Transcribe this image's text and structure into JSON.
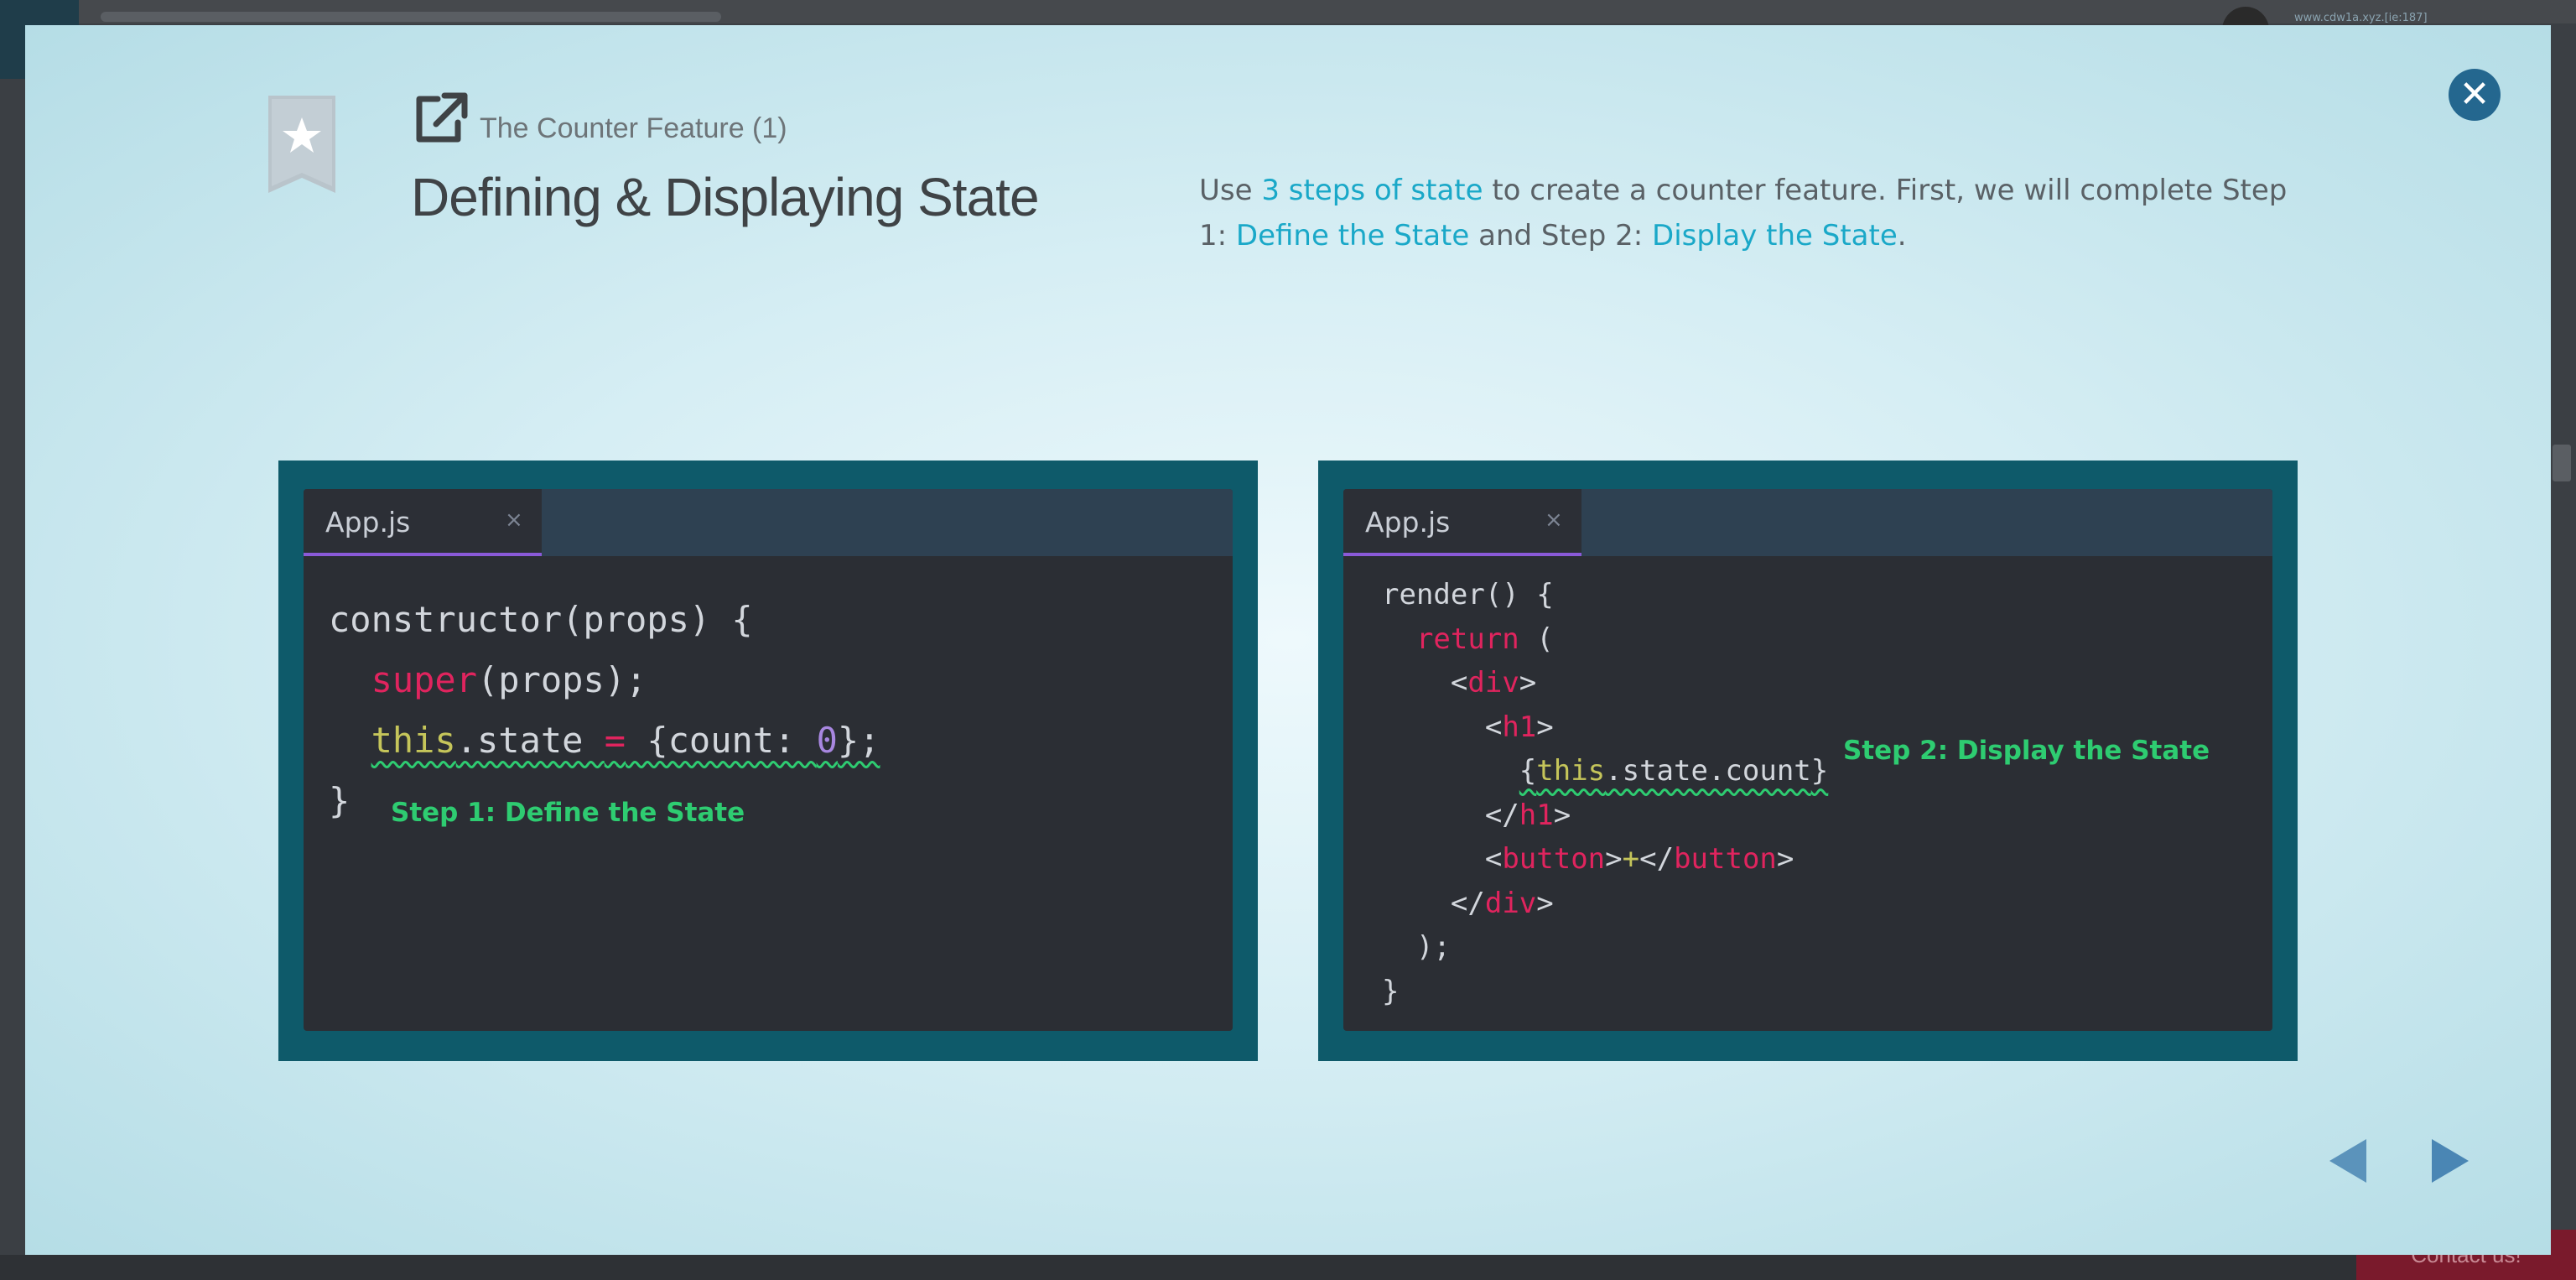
{
  "backdrop": {
    "url_text": "www.cdw1a.xyz.[ie:187]",
    "contact_label": "Contact us!"
  },
  "modal": {
    "kicker": "The Counter Feature (1)",
    "title": "Defining & Displaying State",
    "description": {
      "p1": "Use ",
      "link1": "3 steps of state",
      "p2": " to create a counter feature. First, we will complete Step 1: ",
      "link2": "Define the State",
      "p3": " and Step 2: ",
      "link3": "Display the State",
      "p4": "."
    },
    "close_icon": "close-x-icon",
    "bookmark_icon": "star-bookmark-icon",
    "external_link_icon": "external-link-icon"
  },
  "panels": {
    "left": {
      "tab_label": "App.js",
      "tab_close": "×",
      "code": {
        "l1": "constructor(props) {",
        "l2_kw": "super",
        "l2_rest": "(props);",
        "l3_this": "this",
        "l3_a": ".state ",
        "l3_eq": "=",
        "l3_b": " {count: ",
        "l3_num": "0",
        "l3_c": "};",
        "l4": "}"
      },
      "step_note": "Step 1: Define the State"
    },
    "right": {
      "tab_label": "App.js",
      "tab_close": "×",
      "code": {
        "l1": "render() {",
        "l2_kw": "return",
        "l2_rest": " (",
        "l3_a": "<",
        "l3_tag": "div",
        "l3_b": ">",
        "l4_a": "<",
        "l4_tag": "h1",
        "l4_b": ">",
        "l5_open": "{",
        "l5_this": "this",
        "l5_rest": ".state.count",
        "l5_close": "}",
        "l6_a": "</",
        "l6_tag": "h1",
        "l6_b": ">",
        "l7_a": "<",
        "l7_tag": "button",
        "l7_b": ">",
        "l7_plus": "+",
        "l7_c": "</",
        "l7_tag2": "button",
        "l7_d": ">",
        "l8_a": "</",
        "l8_tag": "div",
        "l8_b": ">",
        "l9": ");",
        "l10": "}"
      },
      "step_note": "Step 2: Display the State"
    }
  },
  "navigation": {
    "prev_icon": "triangle-left-icon",
    "next_icon": "triangle-right-icon"
  },
  "colors": {
    "accent_link": "#1aa8c8",
    "code_keyword": "#e0245e",
    "code_this": "#c5c55a",
    "code_number": "#a887e0",
    "step_note": "#2ecc71",
    "panel_frame": "#0e5a6a",
    "editor_bg": "#2b2e34",
    "close_button": "#24678f",
    "nav_arrow": "#5b93bb"
  }
}
